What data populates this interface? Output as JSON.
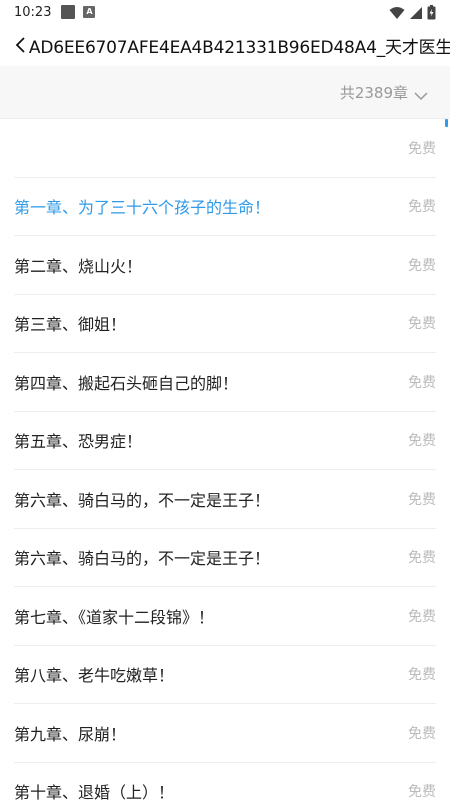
{
  "status_bar": {
    "time": "10:23",
    "icons": [
      "notification-square-icon",
      "a-app-icon",
      "wifi-icon",
      "signal-icon",
      "battery-icon"
    ]
  },
  "header": {
    "title": "AD6EE6707AFE4EA4B421331B96ED48A4_天才医生",
    "back_icon": "back-arrow-icon"
  },
  "summary": {
    "chapter_count": "共2389章",
    "expand_icon": "chevron-down-icon"
  },
  "colors": {
    "accent": "#2f9bea",
    "muted": "#bbbbbb"
  },
  "chapters": [
    {
      "title": "",
      "tag": "免费",
      "active": false
    },
    {
      "title": "第一章、为了三十六个孩子的生命！",
      "tag": "免费",
      "active": true
    },
    {
      "title": "第二章、烧山火！",
      "tag": "免费",
      "active": false
    },
    {
      "title": "第三章、御姐！",
      "tag": "免费",
      "active": false
    },
    {
      "title": "第四章、搬起石头砸自己的脚！",
      "tag": "免费",
      "active": false
    },
    {
      "title": "第五章、恐男症！",
      "tag": "免费",
      "active": false
    },
    {
      "title": "第六章、骑白马的，不一定是王子！",
      "tag": "免费",
      "active": false
    },
    {
      "title": "第六章、骑白马的，不一定是王子！",
      "tag": "免费",
      "active": false
    },
    {
      "title": "第七章、《道家十二段锦》！",
      "tag": "免费",
      "active": false
    },
    {
      "title": "第八章、老牛吃嫩草！",
      "tag": "免费",
      "active": false
    },
    {
      "title": "第九章、尿崩！",
      "tag": "免费",
      "active": false
    },
    {
      "title": "第十章、退婚（上）！",
      "tag": "免费",
      "active": false
    }
  ]
}
